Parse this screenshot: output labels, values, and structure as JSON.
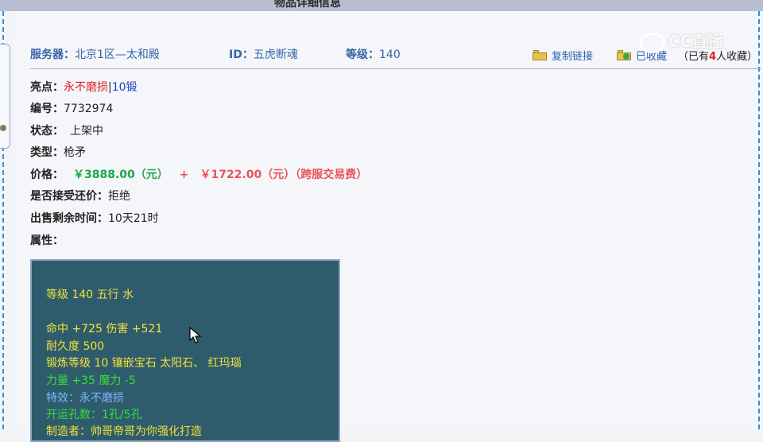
{
  "window": {
    "title": "物品详细信息"
  },
  "header": {
    "server_label": "服务器：",
    "server_value": "北京1区—太和殿",
    "id_label": "ID：",
    "id_value": "五虎断魂",
    "level_label": "等级：",
    "level_value": "140",
    "copy_link": "复制链接",
    "favorited": "已收藏",
    "fav_count_prefix": "（已有",
    "fav_count_num": "4",
    "fav_count_suffix": "人收藏）"
  },
  "watermark": {
    "text": "CC直播"
  },
  "info": {
    "highlight_label": "亮点：",
    "highlight_value": "永不磨损",
    "highlight_sep": "|",
    "highlight_value2": "10锻",
    "number_label": "编号：",
    "number_value": "7732974",
    "status_label": "状态：",
    "status_value": "上架中",
    "type_label": "类型：",
    "type_value": "枪矛",
    "price_label": "价格：",
    "price_main": "￥3888.00（元）",
    "price_plus": "+",
    "price_fee": "￥1722.00（元）（跨服交易费）",
    "counter_label": "是否接受还价：",
    "counter_value": "拒绝",
    "time_label": "出售剩余时间：",
    "time_value": "10天21时",
    "attr_label": "属性："
  },
  "attributes": {
    "line1": "等级 140 五行 水",
    "line2": "命中 +725 伤害 +521",
    "line3": "耐久度 500",
    "line4": "锻炼等级 10 镶嵌宝石 太阳石、 红玛瑙",
    "line5": "力量 +35 魔力 -5",
    "line6": "特效：永不磨损",
    "line7": "开运孔数：1孔/5孔",
    "line8": "制造者：帅哥帝哥为你强化打造"
  },
  "colors": {
    "accent": "#3565a8",
    "price_green": "#19a84a",
    "price_red": "#e8545a",
    "attr_bg": "#2f5c6d",
    "attr_yellow": "#f2e13a",
    "attr_green": "#38df38",
    "attr_blue": "#7ab8ff"
  },
  "icons": {
    "copy_link_icon": "folder-arrow-icon",
    "favorite_icon": "folder-plus-icon",
    "cursor": "mouse-pointer-icon"
  }
}
